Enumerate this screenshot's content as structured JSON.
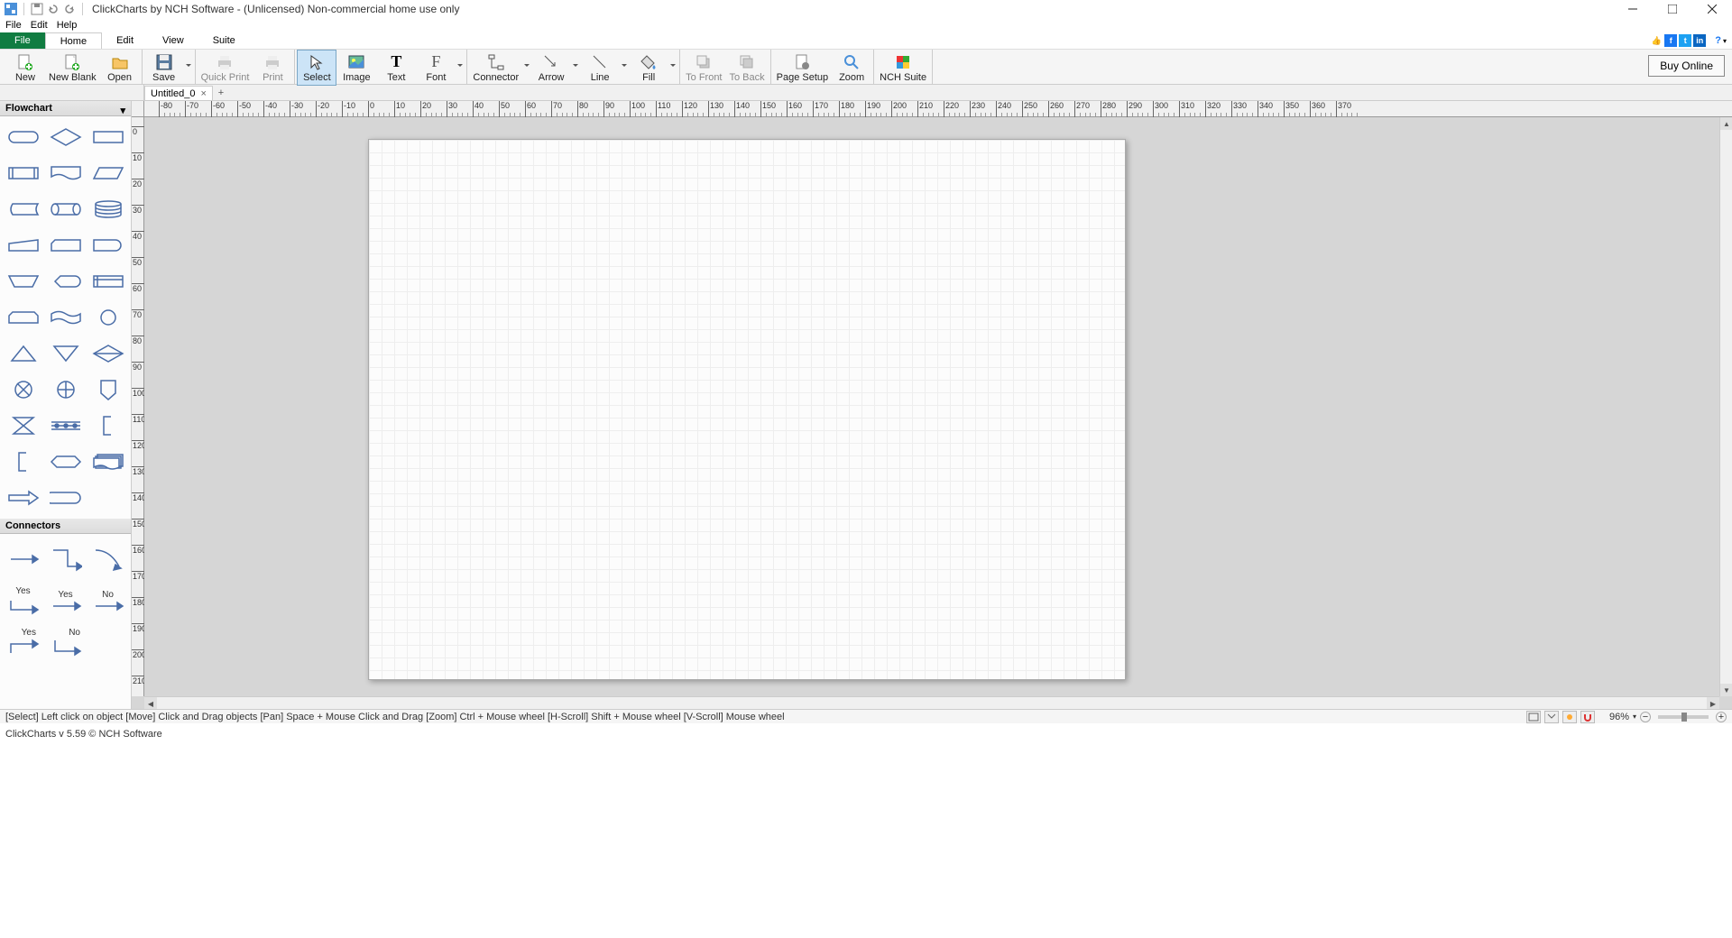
{
  "title": "ClickCharts by NCH Software - (Unlicensed) Non-commercial home use only",
  "menubar": [
    "File",
    "Edit",
    "Help"
  ],
  "tabs": {
    "file": "File",
    "home": "Home",
    "edit": "Edit",
    "view": "View",
    "suite": "Suite"
  },
  "ribbon": {
    "new": "New",
    "newblank": "New Blank",
    "open": "Open",
    "save": "Save",
    "quickprint": "Quick Print",
    "print": "Print",
    "select": "Select",
    "image": "Image",
    "text": "Text",
    "font": "Font",
    "connector": "Connector",
    "arrow": "Arrow",
    "line": "Line",
    "fill": "Fill",
    "tofront": "To Front",
    "toback": "To Back",
    "pagesetup": "Page Setup",
    "zoom": "Zoom",
    "nchsuite": "NCH Suite",
    "buy": "Buy Online"
  },
  "doc": {
    "tab": "Untitled_0"
  },
  "sidebar": {
    "flowchart": "Flowchart",
    "connectors": "Connectors",
    "yes": "Yes",
    "no": "No"
  },
  "ruler_h": [
    -80,
    -70,
    -60,
    -50,
    -40,
    -30,
    -20,
    -10,
    0,
    10,
    20,
    30,
    40,
    50,
    60,
    70,
    80,
    90,
    100,
    110,
    120,
    130,
    140,
    150,
    160,
    170,
    180,
    190,
    200,
    210,
    220,
    230,
    240,
    250,
    260,
    270,
    280,
    290,
    300,
    310,
    320,
    330,
    340,
    350,
    360,
    370
  ],
  "ruler_v": [
    0,
    10,
    20,
    30,
    40,
    50,
    60,
    70,
    80,
    90,
    100,
    110,
    120,
    130,
    140,
    150,
    160,
    170,
    180,
    190,
    200,
    210
  ],
  "status": {
    "hints": "[Select] Left click on object  [Move] Click and Drag objects  [Pan] Space + Mouse Click and Drag  [Zoom] Ctrl + Mouse wheel  [H-Scroll] Shift + Mouse wheel  [V-Scroll] Mouse wheel",
    "zoom": "96%"
  },
  "footer": "ClickCharts v 5.59 © NCH Software"
}
